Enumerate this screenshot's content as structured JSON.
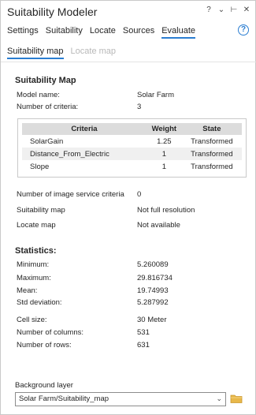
{
  "window": {
    "title": "Suitability Modeler",
    "controls": [
      "?",
      "⌄",
      "⊢",
      "✕"
    ]
  },
  "tabs": [
    "Settings",
    "Suitability",
    "Locate",
    "Sources",
    "Evaluate"
  ],
  "active_tab": "Evaluate",
  "help_label": "?",
  "subtabs": [
    "Suitability map",
    "Locate map"
  ],
  "active_subtab": "Suitability map",
  "suitability_map": {
    "heading": "Suitability Map",
    "model_name_label": "Model name:",
    "model_name_value": "Solar Farm",
    "num_criteria_label": "Number of criteria:",
    "num_criteria_value": "3"
  },
  "criteria_table": {
    "headers": [
      "Criteria",
      "Weight",
      "State"
    ],
    "rows": [
      [
        "SolarGain",
        "1.25",
        "Transformed"
      ],
      [
        "Distance_From_Electric",
        "1",
        "Transformed"
      ],
      [
        "Slope",
        "1",
        "Transformed"
      ]
    ]
  },
  "info": {
    "image_service_label": "Number of image service criteria",
    "image_service_value": "0",
    "suit_map_label": "Suitability map",
    "suit_map_value": "Not full resolution",
    "locate_map_label": "Locate map",
    "locate_map_value": "Not available"
  },
  "statistics": {
    "heading": "Statistics:",
    "min_label": "Minimum:",
    "min_value": "5.260089",
    "max_label": "Maximum:",
    "max_value": "29.816734",
    "mean_label": "Mean:",
    "mean_value": "19.74993",
    "std_label": "Std deviation:",
    "std_value": "5.287992",
    "cell_label": "Cell size:",
    "cell_value": "30 Meter",
    "cols_label": "Number of columns:",
    "cols_value": "531",
    "rows_label": "Number of rows:",
    "rows_value": "631"
  },
  "background_layer": {
    "label": "Background layer",
    "value": "Solar Farm/Suitability_map",
    "arrow": "⌄"
  },
  "colors": {
    "accent": "#2a7dd1",
    "folder": "#e8b84a"
  },
  "icons": {
    "help": "help-icon",
    "folder": "folder-icon"
  }
}
